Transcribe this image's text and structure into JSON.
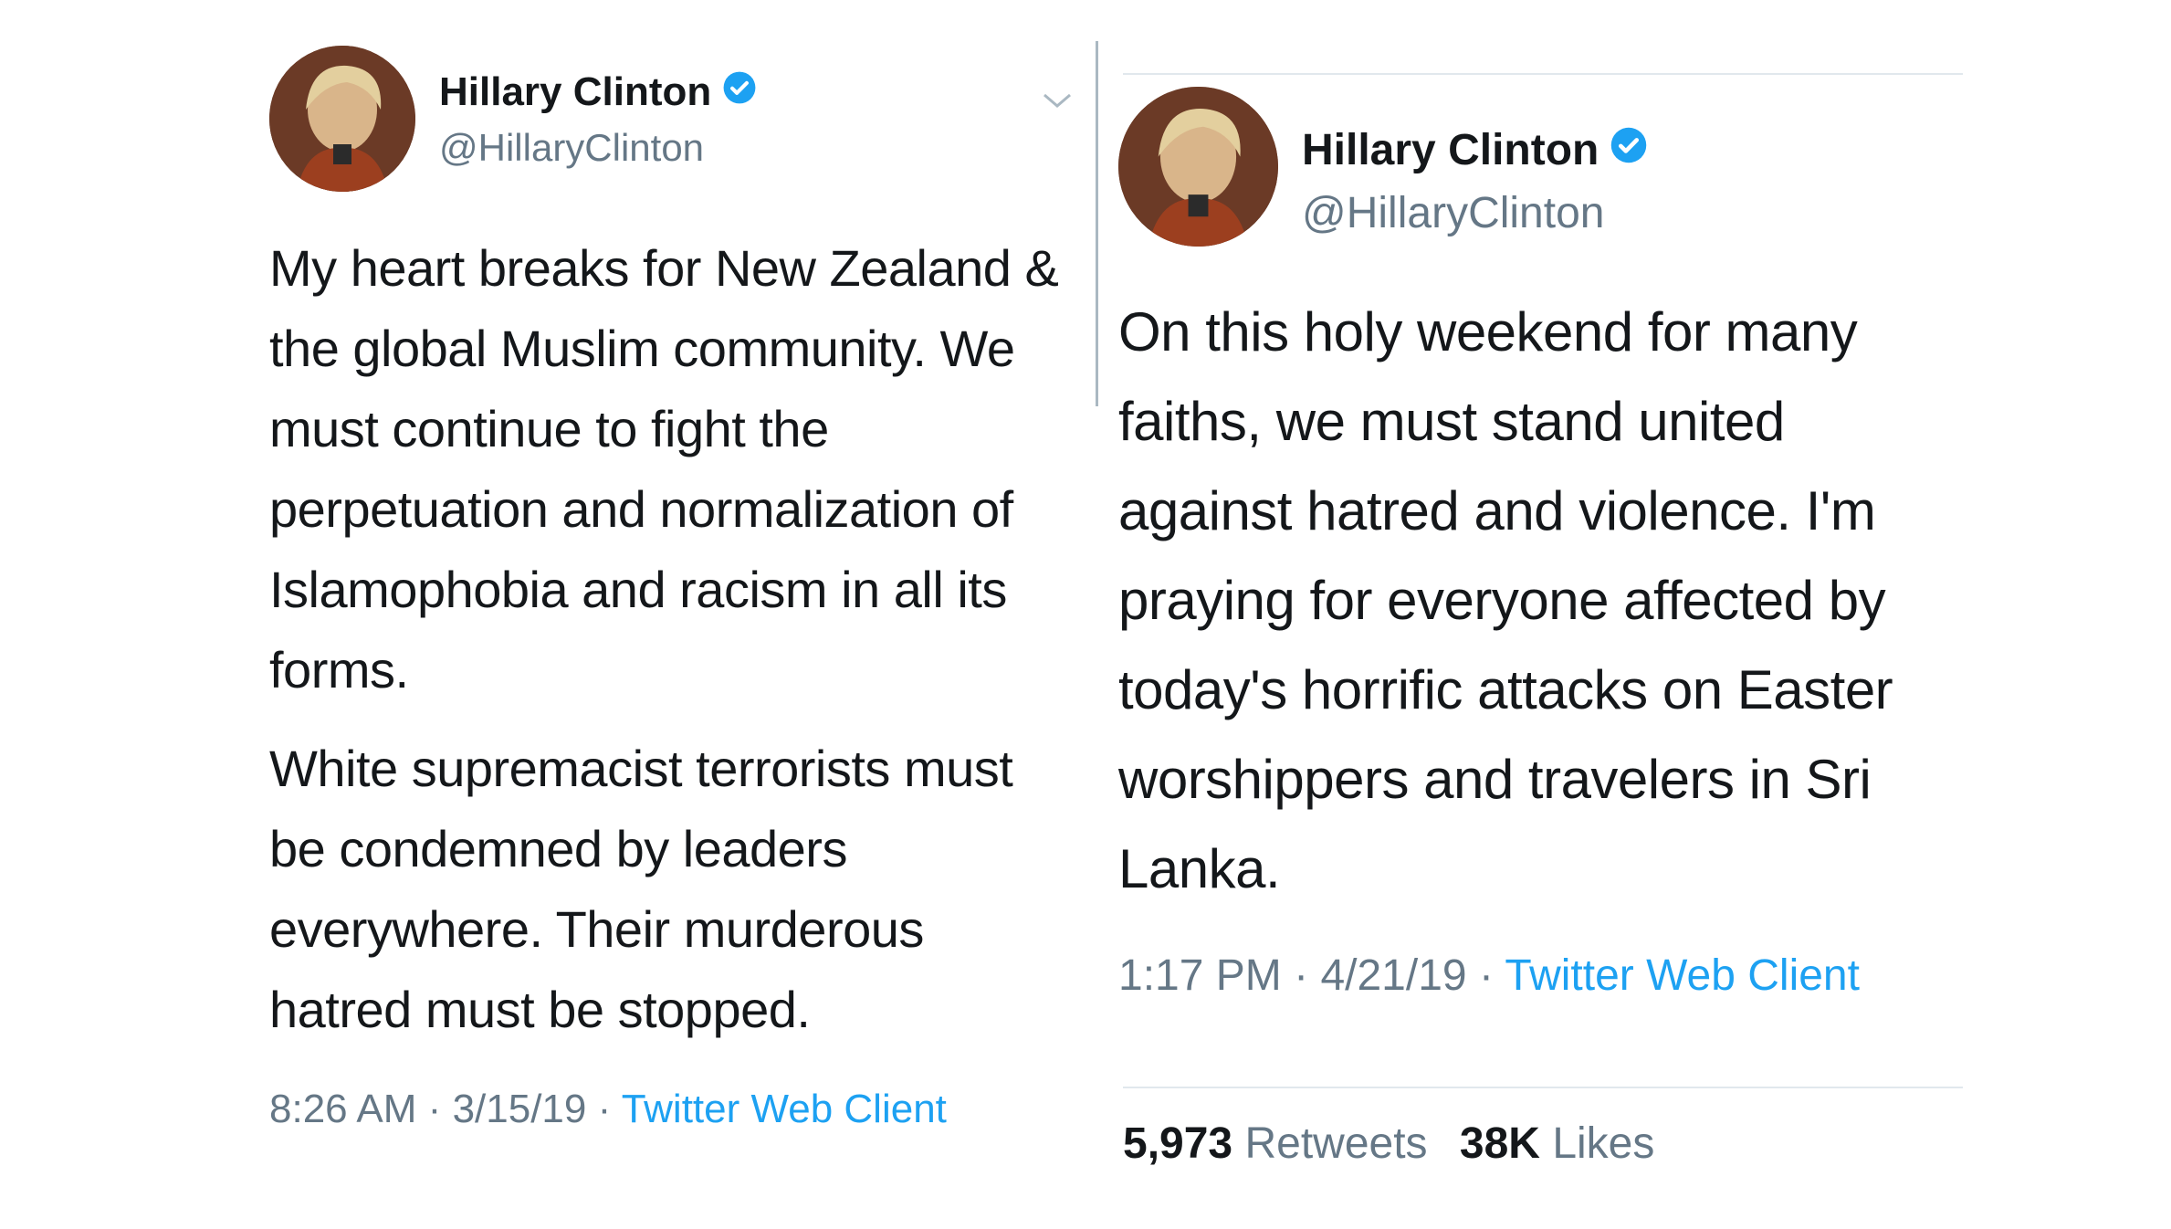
{
  "tweets": [
    {
      "name": "Hillary Clinton",
      "handle": "@HillaryClinton",
      "paragraphs": [
        "My heart breaks for New Zealand & the global Muslim community. We must continue to fight the perpetuation and normalization of Islamophobia and racism in all its forms.",
        "White supremacist terrorists must be condemned by leaders everywhere. Their murderous hatred must be stopped."
      ],
      "time": "8:26 AM",
      "date": "3/15/19",
      "client": "Twitter Web Client",
      "separator": "·"
    },
    {
      "name": "Hillary Clinton",
      "handle": "@HillaryClinton",
      "paragraphs": [
        "On this holy weekend for many faiths, we must stand united against hatred and violence. I'm praying for everyone affected by today's horrific attacks on Easter worshippers and travelers in Sri Lanka."
      ],
      "time": "1:17 PM",
      "date": "4/21/19",
      "client": "Twitter Web Client",
      "separator": "·",
      "retweets_count": "5,973",
      "retweets_label": "Retweets",
      "likes_count": "38K",
      "likes_label": "Likes"
    }
  ],
  "icons": {
    "verified": "verified-badge-icon",
    "menu": "chevron-down-icon"
  },
  "colors": {
    "text": "#14171a",
    "secondary": "#657786",
    "link": "#1da1f2",
    "verified": "#1da1f2"
  }
}
